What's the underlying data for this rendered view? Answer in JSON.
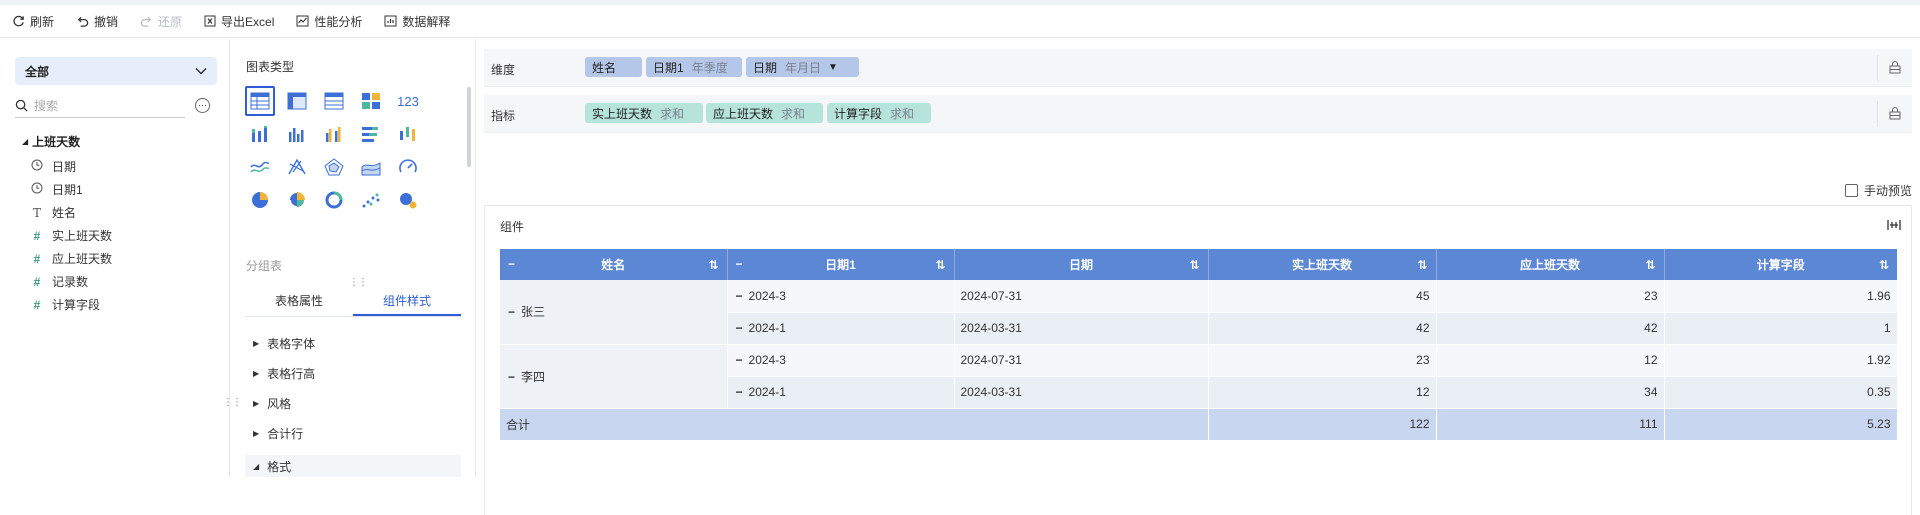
{
  "toolbar": {
    "refresh": "刷新",
    "undo": "撤销",
    "redo": "还原",
    "export": "导出Excel",
    "perf": "性能分析",
    "explain": "数据解释"
  },
  "left": {
    "dataset": "全部",
    "search_placeholder": "搜索",
    "root": "上班天数",
    "fields": [
      {
        "icon": "clock-icon",
        "label": "日期"
      },
      {
        "icon": "clock-icon",
        "label": "日期1"
      },
      {
        "icon": "text-type-icon",
        "label": "姓名"
      },
      {
        "icon": "number-type-icon",
        "label": "实上班天数"
      },
      {
        "icon": "number-type-icon",
        "label": "应上班天数"
      },
      {
        "icon": "number-type-icon",
        "label": "记录数"
      },
      {
        "icon": "calc-number-icon",
        "label": "计算字段"
      }
    ]
  },
  "mid": {
    "chart_type_title": "图表类型",
    "subtitle": "分组表",
    "tabs": [
      "表格属性",
      "组件样式"
    ],
    "props": [
      "表格字体",
      "表格行高",
      "风格",
      "合计行",
      "格式"
    ]
  },
  "dims": {
    "label": "维度",
    "pills": [
      {
        "text": "姓名",
        "sub": ""
      },
      {
        "text": "日期1",
        "sub": "年季度"
      },
      {
        "text": "日期",
        "sub": "年月日"
      }
    ]
  },
  "metrics": {
    "label": "指标",
    "pills": [
      {
        "text": "实上班天数",
        "sub": "求和"
      },
      {
        "text": "应上班天数",
        "sub": "求和"
      },
      {
        "text": "计算字段",
        "sub": "求和"
      }
    ]
  },
  "manual_preview": "手动预览",
  "component_title": "组件",
  "table": {
    "headers": [
      "姓名",
      "日期1",
      "日期",
      "实上班天数",
      "应上班天数",
      "计算字段"
    ],
    "rows": [
      {
        "name": "张三",
        "q": "2024-3",
        "date": "2024-07-31",
        "a": "45",
        "b": "23",
        "c": "1.96"
      },
      {
        "name": "",
        "q": "2024-1",
        "date": "2024-03-31",
        "a": "42",
        "b": "42",
        "c": "1"
      },
      {
        "name": "李四",
        "q": "2024-3",
        "date": "2024-07-31",
        "a": "23",
        "b": "12",
        "c": "1.92"
      },
      {
        "name": "",
        "q": "2024-1",
        "date": "2024-03-31",
        "a": "12",
        "b": "34",
        "c": "0.35"
      }
    ],
    "total": {
      "label": "合计",
      "a": "122",
      "b": "111",
      "c": "5.23"
    }
  },
  "colors": {
    "header": "#5b87d4",
    "accent": "#2f5bd3",
    "dim_pill": "#b5c7e8",
    "metric_pill": "#b6e3da",
    "total_row": "#c9d6ef"
  }
}
